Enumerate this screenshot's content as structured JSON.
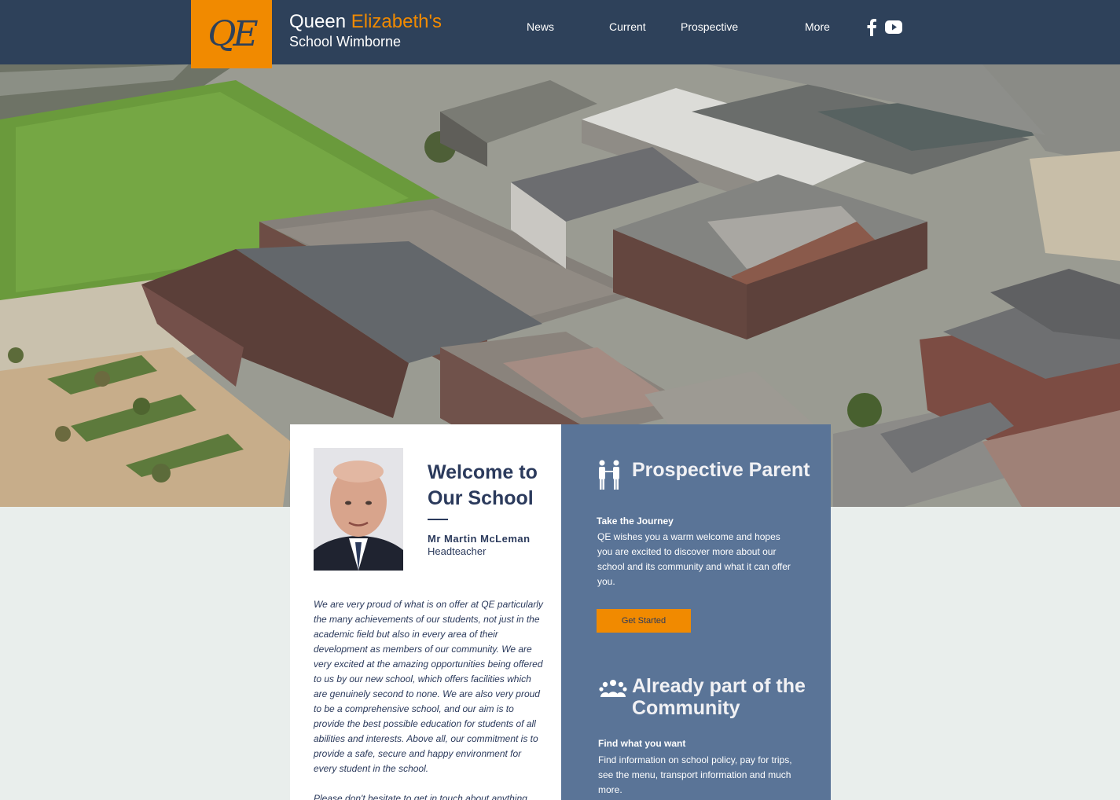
{
  "header": {
    "brand_word1": "Queen",
    "brand_word2": "Elizabeth's",
    "brand_line2": "School Wimborne",
    "logo_text": "QE",
    "nav": [
      "News",
      "Current",
      "Prospective",
      "More"
    ],
    "social_icons": [
      "facebook-icon",
      "youtube-icon"
    ]
  },
  "hero": {
    "image": "aerial-school-campus-photo"
  },
  "welcome": {
    "title": "Welcome to Our School",
    "name": "Mr Martin McLeman",
    "role": "Headteacher",
    "intro_p1": "We are very proud of what is on offer at QE particularly the many achievements of our students, not just in the academic field but also in every area of their development as members of our community. We are very excited at the amazing opportunities being offered to us by our new school, which offers facilities which are genuinely second to none. We are also very proud to be a comprehensive school, and our aim is to provide the best possible education for students of all abilities and interests. Above all, our commitment is to provide a safe, secure and happy environment for every student in the school.",
    "intro_p2": "Please don't hesitate to get in touch about anything"
  },
  "prospective": {
    "title": "Prospective Parent",
    "subtitle": "Take the Journey",
    "body": "QE wishes you a warm welcome and hopes you are excited to discover more about our school and its community and what it can offer you.",
    "button": "Get Started"
  },
  "community": {
    "title": "Already part of the Community",
    "subtitle": "Find what you want",
    "body": "Find information on school policy, pay for trips, see the menu, transport information and much more."
  },
  "colors": {
    "header_bg": "#2e415a",
    "accent_orange": "#f18a00",
    "panel_blue": "#5a7497",
    "text_navy": "#2b3a5c",
    "page_bg": "#e9eeec"
  }
}
